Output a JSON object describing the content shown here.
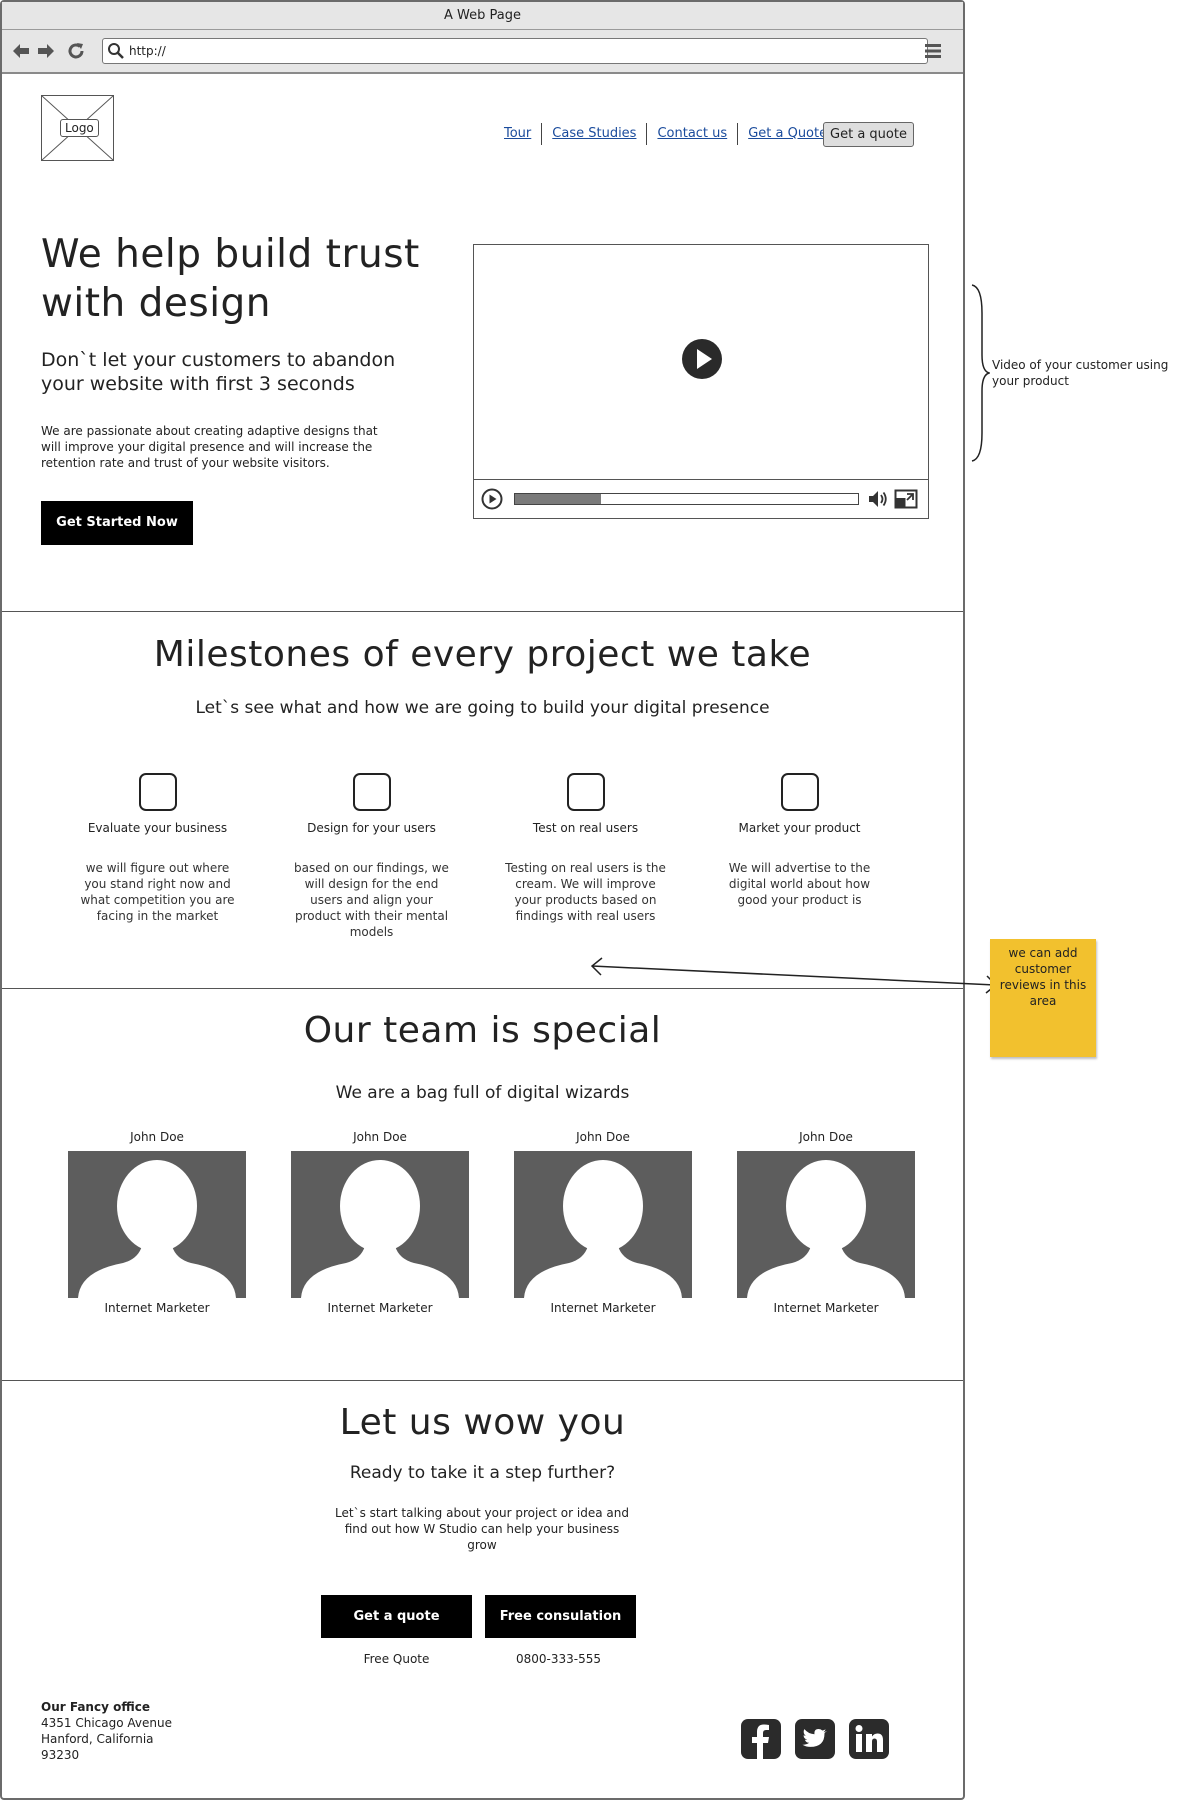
{
  "window": {
    "title": "A Web Page",
    "url": "http://"
  },
  "header": {
    "logo_label": "Logo",
    "nav": [
      {
        "label": "Tour"
      },
      {
        "label": "Case Studies"
      },
      {
        "label": "Contact us"
      },
      {
        "label": "Get a Quote"
      }
    ],
    "quote_button": "Get a quote"
  },
  "hero": {
    "title_line1": "We help build trust",
    "title_line2": "with design",
    "subtitle_line1": "Don`t let your customers to abandon",
    "subtitle_line2": "your website with first 3 seconds",
    "description": "We are passionate about creating adaptive designs that will improve your digital presence and will increase the retention rate and trust of your website visitors.",
    "cta": "Get Started Now",
    "video": {
      "progress_fraction": 0.25
    }
  },
  "milestones": {
    "title": "Milestones of every project we take",
    "subtitle": "Let`s see what and how we are going to build your digital presence",
    "items": [
      {
        "title": "Evaluate your business",
        "description": "we will figure out where you stand right now and what competition you are facing in the market"
      },
      {
        "title": "Design for your users",
        "description": "based on our findings, we will design for the end users and align your product with their mental models"
      },
      {
        "title": "Test on real users",
        "description": "Testing on real users is the cream. We will improve your products based on findings with real users"
      },
      {
        "title": "Market your product",
        "description": "We will advertise to the digital world about how good your product is"
      }
    ]
  },
  "team": {
    "title": "Our team is special",
    "subtitle": "We are a bag full of digital wizards",
    "members": [
      {
        "name": "John Doe",
        "role": "Internet Marketer"
      },
      {
        "name": "John Doe",
        "role": "Internet Marketer"
      },
      {
        "name": "John Doe",
        "role": "Internet Marketer"
      },
      {
        "name": "John Doe",
        "role": "Internet Marketer"
      }
    ]
  },
  "wow": {
    "title": "Let us wow you",
    "subtitle": "Ready to take it a step further?",
    "description": "Let`s start talking about your project or idea and find out how W Studio can help your business grow",
    "buttons": [
      {
        "label": "Get a quote",
        "caption": "Free Quote"
      },
      {
        "label": "Free consulation",
        "caption": "0800-333-555"
      }
    ]
  },
  "footer": {
    "office_name": "Our Fancy office",
    "address_line1": "4351 Chicago Avenue",
    "address_line2": "Hanford, California",
    "address_line3": "93230",
    "social_icons": [
      "facebook-icon",
      "twitter-icon",
      "linkedin-icon"
    ]
  },
  "annotations": {
    "video_note": "Video of your customer using your product",
    "sticky_note": "we can add customer reviews in this area",
    "sticky_color": "#f2c12e"
  }
}
